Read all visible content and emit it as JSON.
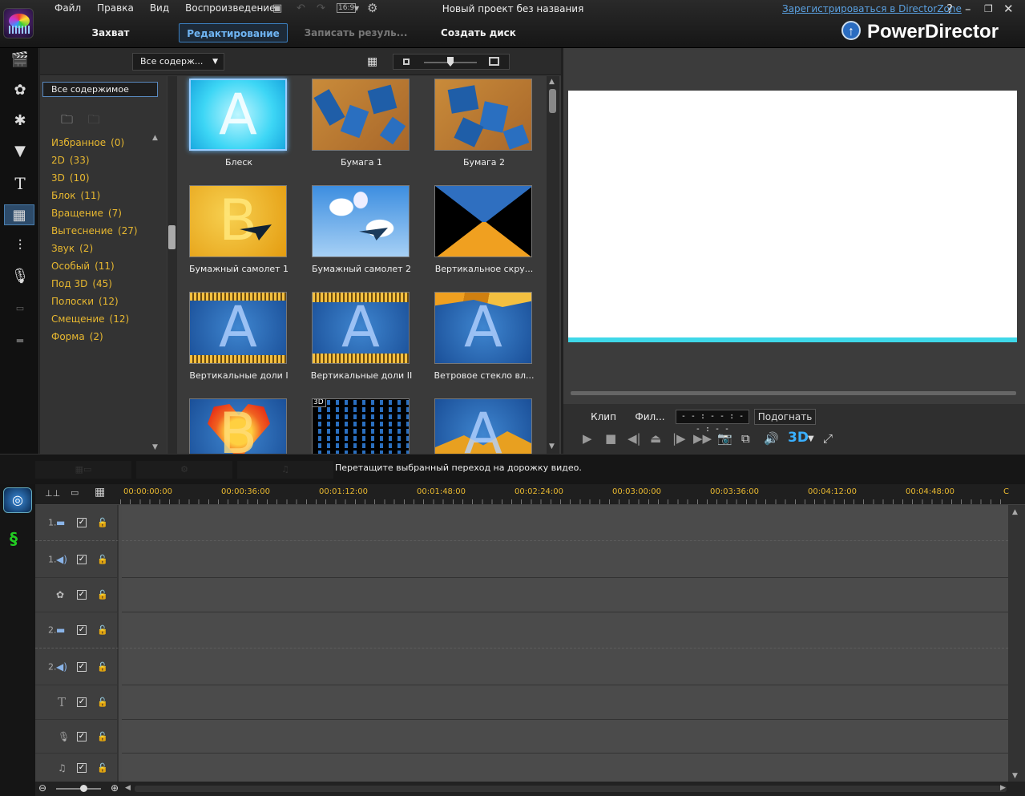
{
  "menu": [
    "Файл",
    "Правка",
    "Вид",
    "Воспроизведение"
  ],
  "toolbar": {
    "aspect": "16:9"
  },
  "window": {
    "title": "Новый проект без названия",
    "register_link": "Зарегистрироваться в DirectorZone",
    "help": "?"
  },
  "modes": [
    {
      "label": "Захват",
      "state": "normal"
    },
    {
      "label": "Редактирование",
      "state": "active"
    },
    {
      "label": "Записать резуль...",
      "state": "disabled"
    },
    {
      "label": "Создать диск",
      "state": "normal"
    }
  ],
  "brand": "PowerDirector",
  "library": {
    "filter": "Все содерж...",
    "category_selected": "Все содержимое",
    "categories": [
      {
        "name": "Избранное",
        "count": "(0)"
      },
      {
        "name": "2D",
        "count": "(33)"
      },
      {
        "name": "3D",
        "count": "(10)"
      },
      {
        "name": "Блок",
        "count": "(11)"
      },
      {
        "name": "Вращение",
        "count": "(7)"
      },
      {
        "name": "Вытеснение",
        "count": "(27)"
      },
      {
        "name": "Звук",
        "count": "(2)"
      },
      {
        "name": "Особый",
        "count": "(11)"
      },
      {
        "name": "Под 3D",
        "count": "(45)"
      },
      {
        "name": "Полоски",
        "count": "(12)"
      },
      {
        "name": "Смещение",
        "count": "(12)"
      },
      {
        "name": "Форма",
        "count": "(2)"
      }
    ],
    "items": [
      {
        "caption": "Блеск",
        "letter": "A"
      },
      {
        "caption": "Бумага 1",
        "letter": ""
      },
      {
        "caption": "Бумага 2",
        "letter": ""
      },
      {
        "caption": "Бумажный самолет 1",
        "letter": "B"
      },
      {
        "caption": "Бумажный самолет 2",
        "letter": ""
      },
      {
        "caption": "Вертикальное скру...",
        "letter": ""
      },
      {
        "caption": "Вертикальные доли I",
        "letter": "A"
      },
      {
        "caption": "Вертикальные доли II",
        "letter": "A"
      },
      {
        "caption": "Ветровое стекло вл...",
        "letter": "A"
      },
      {
        "caption": "",
        "letter": "B"
      },
      {
        "caption": "",
        "letter": "",
        "badge": "3D"
      },
      {
        "caption": "",
        "letter": "A"
      }
    ]
  },
  "preview": {
    "tab_clip": "Клип",
    "tab_film": "Фил...",
    "timecode": "- - : - - : - - : - -",
    "fit": "Подогнать",
    "btn3d": "3D"
  },
  "hint": "Перетащите выбранный переход на дорожку видео.",
  "timeline": {
    "ruler": [
      "00:00:00:00",
      "00:00:36:00",
      "00:01:12:00",
      "00:01:48:00",
      "00:02:24:00",
      "00:03:00:00",
      "00:03:36:00",
      "00:04:12:00",
      "00:04:48:00",
      "C"
    ],
    "tracks": [
      {
        "num": "1.",
        "type": "video"
      },
      {
        "num": "1.",
        "type": "audio"
      },
      {
        "num": "",
        "type": "fx"
      },
      {
        "num": "2.",
        "type": "video"
      },
      {
        "num": "2.",
        "type": "audio"
      },
      {
        "num": "",
        "type": "title"
      },
      {
        "num": "",
        "type": "voice"
      },
      {
        "num": "",
        "type": "music"
      }
    ]
  }
}
